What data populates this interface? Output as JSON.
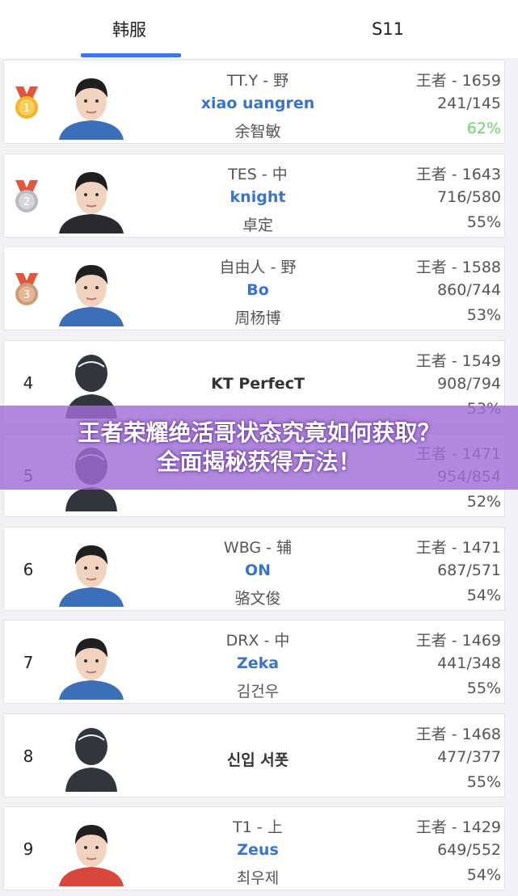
{
  "tabs": {
    "region": "韩服",
    "season": "S11"
  },
  "players": [
    {
      "rank": "1",
      "medal": "gold",
      "team_pos": "TT.Y - 野",
      "id": "xiao   uangren",
      "real_name": "余智敏",
      "tier_score": "王者 - 1659",
      "record": "241/145",
      "winrate": "62%",
      "winrate_highlight": true,
      "avatar": "photo"
    },
    {
      "rank": "2",
      "medal": "silver",
      "team_pos": "TES - 中",
      "id": "knight",
      "real_name": "卓定",
      "tier_score": "王者 - 1643",
      "record": "716/580",
      "winrate": "55%",
      "avatar": "photo"
    },
    {
      "rank": "3",
      "medal": "bronze",
      "team_pos": "自由人 - 野",
      "id": "Bo",
      "real_name": "周杨博",
      "tier_score": "王者 - 1588",
      "record": "860/744",
      "winrate": "53%",
      "avatar": "photo"
    },
    {
      "rank": "4",
      "team_pos": "",
      "id": "KT PerfecT",
      "real_name": "",
      "tier_score": "王者 - 1549",
      "record": "908/794",
      "winrate": "53%",
      "avatar": "placeholder"
    },
    {
      "rank": "5",
      "team_pos": "",
      "id": "",
      "real_name": "",
      "tier_score": "王者 - 1471",
      "record": "954/854",
      "winrate": "52%",
      "avatar": "placeholder"
    },
    {
      "rank": "6",
      "team_pos": "WBG - 辅",
      "id": "ON",
      "real_name": "骆文俊",
      "tier_score": "王者 - 1471",
      "record": "687/571",
      "winrate": "54%",
      "avatar": "photo"
    },
    {
      "rank": "7",
      "team_pos": "DRX - 中",
      "id": "Zeka",
      "real_name": "김건우",
      "tier_score": "王者 - 1469",
      "record": "441/348",
      "winrate": "55%",
      "avatar": "photo"
    },
    {
      "rank": "8",
      "team_pos": "",
      "id": "신입 서폿",
      "real_name": "",
      "tier_score": "王者 - 1468",
      "record": "477/377",
      "winrate": "55%",
      "avatar": "placeholder"
    },
    {
      "rank": "9",
      "team_pos": "T1 - 上",
      "id": "Zeus",
      "real_name": "최우제",
      "tier_score": "王者 - 1429",
      "record": "649/552",
      "winrate": "54%",
      "avatar": "photo"
    }
  ],
  "banner": {
    "line1": "王者荣耀绝活哥状态究竟如何获取？",
    "line2": "全面揭秘获得方法！"
  },
  "colors": {
    "accent": "#3b78e7",
    "link": "#3a73c8",
    "winrate_high": "#6cd36a",
    "banner_bg": "#a06ed7"
  }
}
